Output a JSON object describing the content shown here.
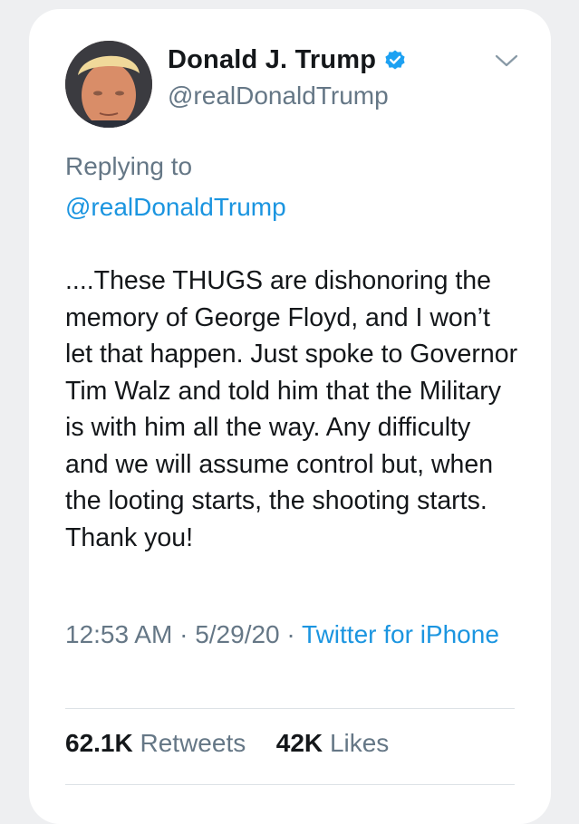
{
  "user": {
    "display_name": "Donald J. Trump",
    "handle": "@realDonaldTrump",
    "verified": true
  },
  "reply": {
    "label": "Replying to",
    "handle": "@realDonaldTrump"
  },
  "tweet": {
    "text": "....These THUGS are dishonoring the memory of George Floyd, and I won’t let that happen. Just spoke to Governor Tim Walz and told him that the Military is with him all the way. Any difficulty and we will assume control but, when the looting starts, the shooting starts. Thank you!",
    "time": "12:53 AM",
    "date": "5/29/20",
    "source": "Twitter for iPhone"
  },
  "stats": {
    "retweets_count": "62.1K",
    "retweets_label": "Retweets",
    "likes_count": "42K",
    "likes_label": "Likes"
  },
  "colors": {
    "link_blue": "#1b95e0",
    "secondary_gray": "#657786",
    "text_dark": "#14171a",
    "verified_blue": "#1da1f2"
  },
  "icons": {
    "verified": "verified-badge-icon",
    "menu": "chevron-down-icon"
  }
}
